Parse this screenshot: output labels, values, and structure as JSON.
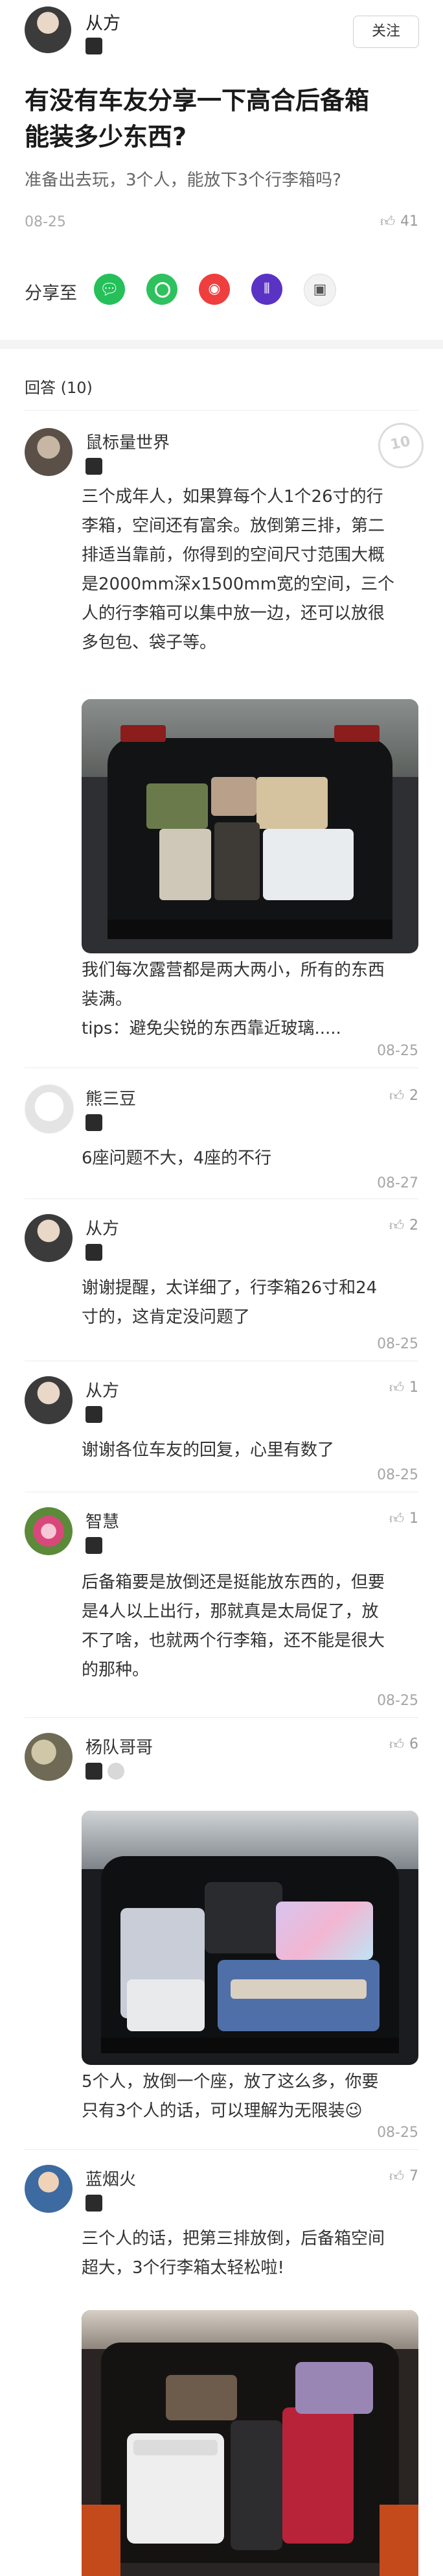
{
  "header": {
    "author": "从方",
    "follow_label": "关注"
  },
  "question": {
    "title_line1": "有没有车友分享一下高合后备箱",
    "title_line2": "能装多少东西?",
    "description": "准备出去玩，3个人，能放下3个行李箱吗?",
    "date": "08-25",
    "likes": "41"
  },
  "share": {
    "label": "分享至"
  },
  "answers_header": "回答 (10)",
  "answers": [
    {
      "name": "鼠标量世界",
      "lines": [
        "三个成年人，如果算每个人1个26寸的行",
        "李箱，空间还有富余。放倒第三排，第二",
        "排适当靠前，你得到的空间尺寸范围大概",
        "是2000mm深x1500mm宽的空间，三个",
        "人的行李箱可以集中放一边，还可以放很",
        "多包包、袋子等。"
      ],
      "caption_lines": [
        "我们每次露营都是两大两小，所有的东西",
        "装满。",
        "tips：避免尖锐的东西靠近玻璃....."
      ],
      "date": "08-25",
      "stamp": "10"
    },
    {
      "name": "熊三豆",
      "lines": [
        "6座问题不大，4座的不行"
      ],
      "date": "08-27",
      "likes": "2"
    },
    {
      "name": "从方",
      "lines": [
        "谢谢提醒，太详细了，行李箱26寸和24",
        "寸的，这肯定没问题了"
      ],
      "date": "08-25",
      "likes": "2"
    },
    {
      "name": "从方",
      "lines": [
        "谢谢各位车友的回复，心里有数了"
      ],
      "date": "08-25",
      "likes": "1"
    },
    {
      "name": "智慧",
      "lines": [
        "后备箱要是放倒还是挺能放东西的，但要",
        "是4人以上出行，那就真是太局促了，放",
        "不了啥，也就两个行李箱，还不能是很大",
        "的那种。"
      ],
      "date": "08-25",
      "likes": "1"
    },
    {
      "name": "杨队哥哥",
      "caption_lines": [
        "5个人，放倒一个座，放了这么多，你要",
        "只有3个人的话，可以理解为无限装😉"
      ],
      "date": "08-25",
      "likes": "6"
    },
    {
      "name": "蓝烟火",
      "lines": [
        "三个人的话，把第三排放倒，后备箱空间",
        "超大，3个行李箱太轻松啦!"
      ],
      "likes": "7"
    }
  ]
}
